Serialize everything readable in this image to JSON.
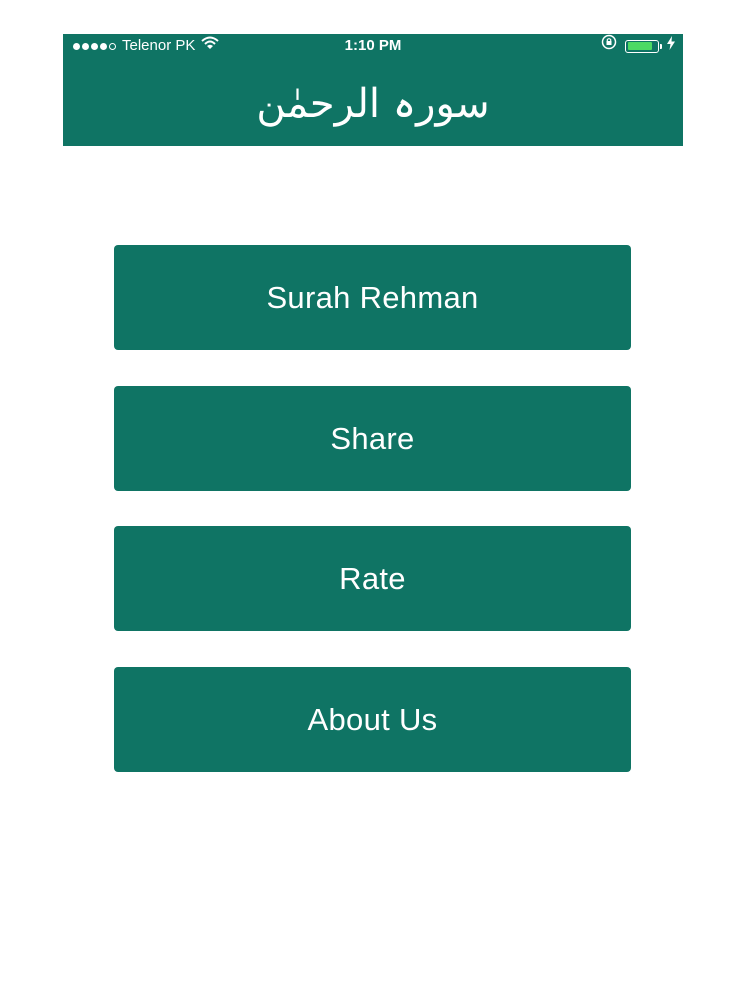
{
  "status_bar": {
    "carrier": "Telenor PK",
    "time": "1:10 PM",
    "battery_level": 0.85,
    "icons": [
      "signal-dots-icon",
      "wifi-icon",
      "orientation-lock-icon",
      "battery-icon",
      "charging-bolt-icon"
    ]
  },
  "header": {
    "title": "سورہ الرحمٰن"
  },
  "menu": {
    "surah_label": "Surah Rehman",
    "share_label": "Share",
    "rate_label": "Rate",
    "about_label": "About Us"
  },
  "colors": {
    "primary": "#0f7464",
    "text": "#ffffff",
    "battery": "#4cd964"
  }
}
